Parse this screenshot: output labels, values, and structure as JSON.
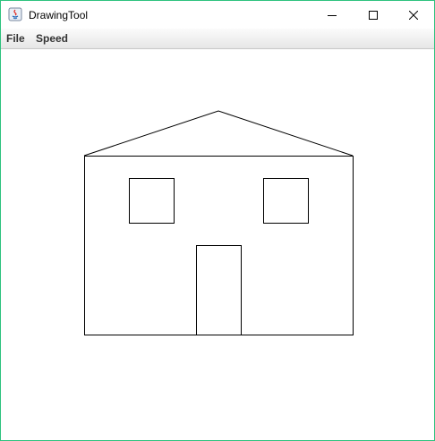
{
  "window": {
    "title": "DrawingTool",
    "border_color": "#2ec27e",
    "controls": [
      "minimize-icon",
      "maximize-icon",
      "close-icon"
    ],
    "app_icon": "java-icon"
  },
  "menubar": {
    "items": [
      {
        "label": "File"
      },
      {
        "label": "Speed"
      }
    ]
  },
  "canvas": {
    "background": "#ffffff",
    "drawing": {
      "subject": "house",
      "stroke_color": "#000000",
      "parts": [
        "roof",
        "wall",
        "left-window",
        "right-window",
        "door"
      ]
    }
  }
}
